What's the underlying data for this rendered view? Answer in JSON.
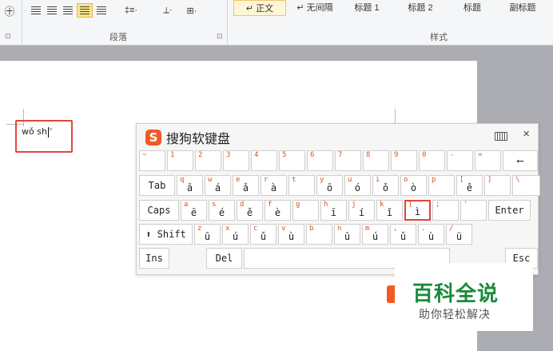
{
  "ribbon": {
    "font_icon": "㊉",
    "paragraph_label": "段落",
    "styles_label": "样式",
    "line_spacing_label": "‡≡·",
    "shading_label": "⟂·",
    "border_label": "⊞·",
    "styles": [
      "↵ 正文",
      "↵ 无间隔",
      "标题 1",
      "标题 2",
      "标题",
      "副标题"
    ],
    "launcher_glyph": "⊡",
    "highlight_color": "#fde58a"
  },
  "document": {
    "typed_before": "wǒ sh",
    "typed_after": "ᵘ"
  },
  "ime": {
    "title": "搜狗软键盘",
    "logo_letter": "S",
    "close_glyph": "×",
    "rows": [
      [
        {
          "small": "~",
          "big": ""
        },
        {
          "small": "1",
          "big": ""
        },
        {
          "small": "2",
          "big": ""
        },
        {
          "small": "3",
          "big": ""
        },
        {
          "small": "4",
          "big": ""
        },
        {
          "small": "5",
          "big": ""
        },
        {
          "small": "6",
          "big": ""
        },
        {
          "small": "7",
          "big": ""
        },
        {
          "small": "8",
          "big": ""
        },
        {
          "small": "9",
          "big": ""
        },
        {
          "small": "0",
          "big": ""
        },
        {
          "small": "-",
          "big": ""
        },
        {
          "small": "=",
          "big": ""
        },
        {
          "label": "⟵"
        }
      ],
      [
        {
          "label": "Tab"
        },
        {
          "small": "q",
          "big": "ā"
        },
        {
          "small": "w",
          "big": "á"
        },
        {
          "small": "e",
          "big": "ǎ"
        },
        {
          "small": "r",
          "big": "à"
        },
        {
          "small": "t",
          "big": ""
        },
        {
          "small": "y",
          "big": "ō"
        },
        {
          "small": "u",
          "big": "ó"
        },
        {
          "small": "i",
          "big": "ǒ"
        },
        {
          "small": "o",
          "big": "ò"
        },
        {
          "small": "p",
          "big": ""
        },
        {
          "small": "[",
          "big": "ê"
        },
        {
          "small": "]",
          "big": ""
        },
        {
          "small": "\\",
          "big": ""
        }
      ],
      [
        {
          "label": "Caps"
        },
        {
          "small": "a",
          "big": "ē"
        },
        {
          "small": "s",
          "big": "é"
        },
        {
          "small": "d",
          "big": "ě"
        },
        {
          "small": "f",
          "big": "è"
        },
        {
          "small": "g",
          "big": ""
        },
        {
          "small": "h",
          "big": "ī"
        },
        {
          "small": "j",
          "big": "í"
        },
        {
          "small": "k",
          "big": "ǐ"
        },
        {
          "small": "l",
          "big": "ì"
        },
        {
          "small": ";",
          "big": ""
        },
        {
          "small": "'",
          "big": ""
        },
        {
          "label": "Enter"
        }
      ],
      [
        {
          "label": "⬆ Shift"
        },
        {
          "small": "z",
          "big": "ū"
        },
        {
          "small": "x",
          "big": "ú"
        },
        {
          "small": "c",
          "big": "ǔ"
        },
        {
          "small": "v",
          "big": "ù"
        },
        {
          "small": "b",
          "big": ""
        },
        {
          "small": "n",
          "big": "ū"
        },
        {
          "small": "m",
          "big": "ú"
        },
        {
          "small": ",",
          "big": "ǔ"
        },
        {
          "small": ".",
          "big": "ù"
        },
        {
          "small": "/",
          "big": "ü"
        }
      ],
      [
        {
          "label": "Ins"
        },
        {
          "label": "Del"
        },
        {
          "label": ""
        },
        {
          "label": "Esc"
        }
      ]
    ]
  },
  "watermark": {
    "main": "百科全说",
    "sub": "助你轻松解决",
    "color": "#1a8a3a"
  },
  "accent_red": "#e0463d"
}
